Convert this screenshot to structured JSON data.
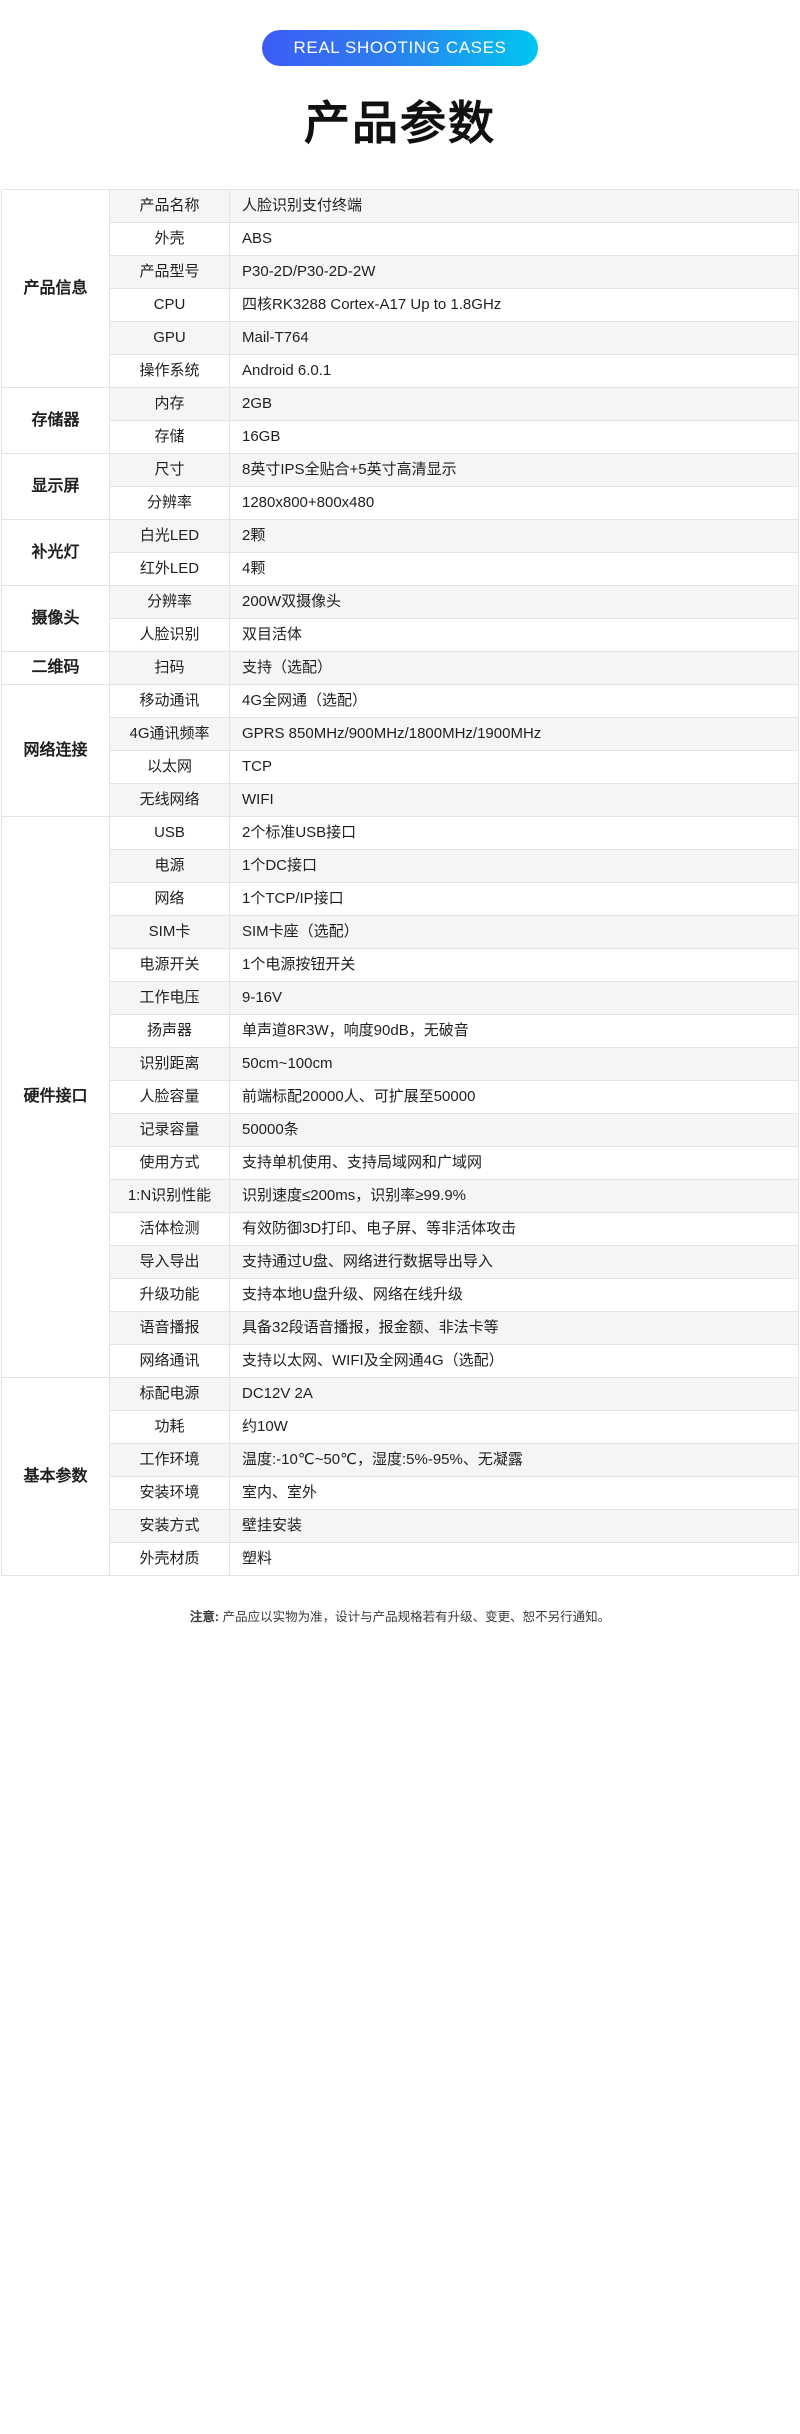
{
  "header": {
    "badge_label": "REAL SHOOTING CASES",
    "title": "产品参数",
    "badge_gradient_from": "#3d5cf5",
    "badge_gradient_to": "#00c6f0"
  },
  "table": {
    "sections": [
      {
        "category": "产品信息",
        "rows": [
          {
            "key": "产品名称",
            "value": "人脸识别支付终端"
          },
          {
            "key": "外壳",
            "value": "ABS"
          },
          {
            "key": "产品型号",
            "value": "P30-2D/P30-2D-2W"
          },
          {
            "key": "CPU",
            "value": "四核RK3288 Cortex-A17 Up to 1.8GHz"
          },
          {
            "key": "GPU",
            "value": "Mail-T764"
          },
          {
            "key": "操作系统",
            "value": "Android 6.0.1"
          }
        ]
      },
      {
        "category": "存储器",
        "rows": [
          {
            "key": "内存",
            "value": "2GB"
          },
          {
            "key": "存储",
            "value": "16GB"
          }
        ]
      },
      {
        "category": "显示屏",
        "rows": [
          {
            "key": "尺寸",
            "value": "8英寸IPS全贴合+5英寸高清显示"
          },
          {
            "key": "分辨率",
            "value": "1280x800+800x480"
          }
        ]
      },
      {
        "category": "补光灯",
        "rows": [
          {
            "key": "白光LED",
            "value": "2颗"
          },
          {
            "key": "红外LED",
            "value": "4颗"
          }
        ]
      },
      {
        "category": "摄像头",
        "rows": [
          {
            "key": "分辨率",
            "value": "200W双摄像头"
          },
          {
            "key": "人脸识别",
            "value": "双目活体"
          }
        ]
      },
      {
        "category": "二维码",
        "rows": [
          {
            "key": "扫码",
            "value": "支持（选配）"
          }
        ]
      },
      {
        "category": "网络连接",
        "rows": [
          {
            "key": "移动通讯",
            "value": "4G全网通（选配）"
          },
          {
            "key": "4G通讯频率",
            "value": "GPRS  850MHz/900MHz/1800MHz/1900MHz"
          },
          {
            "key": "以太网",
            "value": "TCP"
          },
          {
            "key": "无线网络",
            "value": "WIFI"
          }
        ]
      },
      {
        "category": "硬件接口",
        "rows": [
          {
            "key": "USB",
            "value": "2个标准USB接口"
          },
          {
            "key": "电源",
            "value": "1个DC接口"
          },
          {
            "key": "网络",
            "value": "1个TCP/IP接口"
          },
          {
            "key": "SIM卡",
            "value": "SIM卡座（选配）"
          },
          {
            "key": "电源开关",
            "value": "1个电源按钮开关"
          },
          {
            "key": "工作电压",
            "value": "9-16V"
          },
          {
            "key": "扬声器",
            "value": "单声道8R3W，响度90dB，无破音"
          },
          {
            "key": "识别距离",
            "value": "50cm~100cm"
          },
          {
            "key": "人脸容量",
            "value": "前端标配20000人、可扩展至50000"
          },
          {
            "key": "记录容量",
            "value": "50000条"
          },
          {
            "key": "使用方式",
            "value": "支持单机使用、支持局域网和广域网"
          },
          {
            "key": "1:N识别性能",
            "value": "识别速度≤200ms，识别率≥99.9%"
          },
          {
            "key": "活体检测",
            "value": "有效防御3D打印、电子屏、等非活体攻击"
          },
          {
            "key": "导入导出",
            "value": "支持通过U盘、网络进行数据导出导入"
          },
          {
            "key": "升级功能",
            "value": "支持本地U盘升级、网络在线升级"
          },
          {
            "key": "语音播报",
            "value": "具备32段语音播报，报金额、非法卡等"
          },
          {
            "key": "网络通讯",
            "value": "支持以太网、WIFI及全网通4G（选配）"
          }
        ]
      },
      {
        "category": "基本参数",
        "rows": [
          {
            "key": "标配电源",
            "value": "DC12V  2A"
          },
          {
            "key": "功耗",
            "value": "约10W"
          },
          {
            "key": "工作环境",
            "value": "温度:-10℃~50℃，湿度:5%-95%、无凝露"
          },
          {
            "key": "安装环境",
            "value": "室内、室外"
          },
          {
            "key": "安装方式",
            "value": "壁挂安装"
          },
          {
            "key": "外壳材质",
            "value": "塑料"
          }
        ]
      }
    ]
  },
  "footer": {
    "note_label": "注意:",
    "note_text": "产品应以实物为准，设计与产品规格若有升级、变更、恕不另行通知。"
  }
}
